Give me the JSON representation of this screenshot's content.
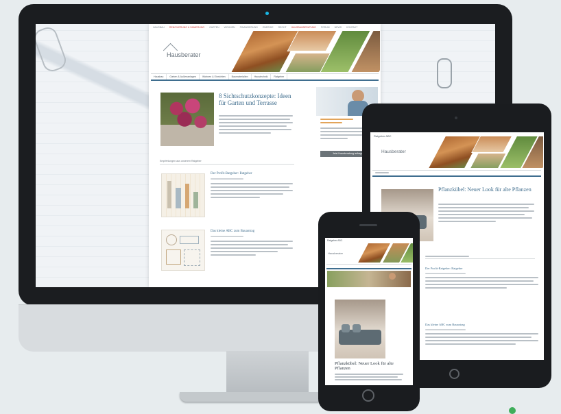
{
  "site": {
    "logo": "Hausberater",
    "top_nav": [
      "HAUSBAU",
      "RENOVIERUNG & SANIERUNG",
      "GARTEN",
      "WOHNEN",
      "FINANZIERUNG",
      "ENERGIE",
      "RECHT",
      "HAUSBAUBERATUNG",
      "FORUM",
      "NEWS",
      "KONTAKT"
    ],
    "main_nav": [
      "Hausbau",
      "Garten & Außenanlagen",
      "Wohnen & Einrichten",
      "Baumaterialien",
      "Haustechnik",
      "Ratgeber"
    ],
    "featured_title": "8 Sichtschutzkonzepte: Ideen für Garten und Terrasse",
    "recommended_heading": "Empfehlungen aus unserem Ratgeber",
    "articles": [
      {
        "title": "Der Profit-Ratgeber: Ratgeber"
      },
      {
        "title": "Das kleine ABC zum Bauantrag"
      }
    ],
    "sidebar_button": "Jetzt Hausberatung anfragen"
  },
  "tablet": {
    "top_label": "Ratgeber ABC",
    "featured_title": "Pflanzkübel: Neuer Look für alte Pflanzen",
    "articles": [
      {
        "title": "Der Profit-Ratgeber: Ratgeber"
      },
      {
        "title": "Das kleine ABC zum Bauantrag"
      }
    ]
  },
  "phone": {
    "top_label": "Ratgeber ABC",
    "featured_title": "Pflanzkübel: Neuer Look für alte Pflanzen"
  },
  "colors": {
    "accent": "#3e6c8c",
    "highlight": "#d23a35",
    "device": "#1a1c1f"
  }
}
